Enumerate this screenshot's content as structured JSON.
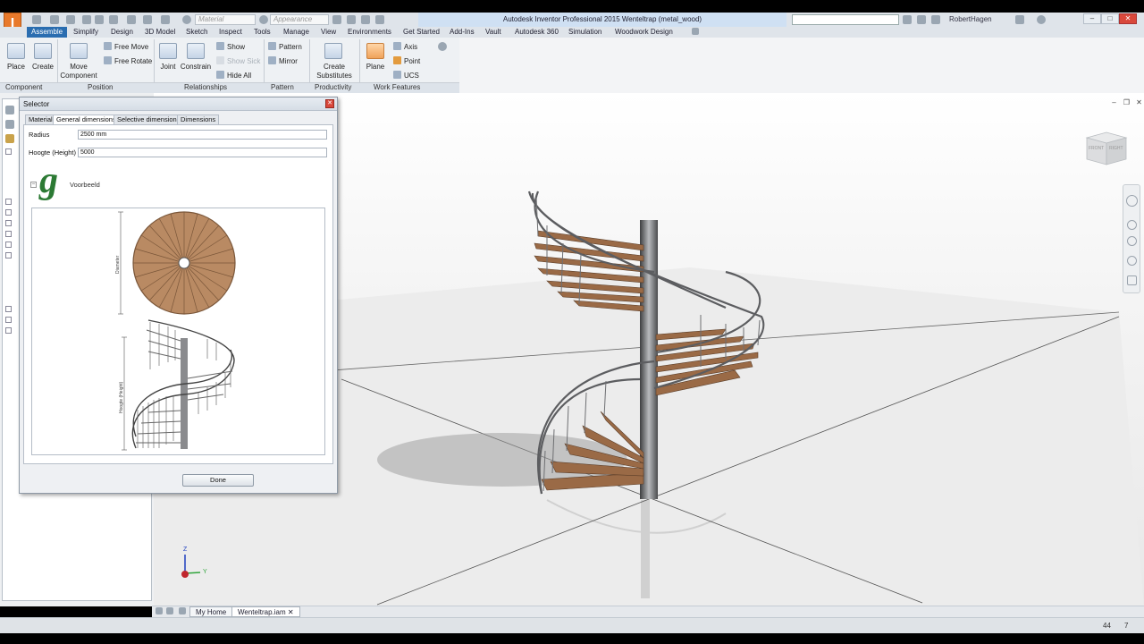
{
  "app": {
    "logo": "I",
    "title": "Autodesk Inventor Professional 2015   Wenteltrap (metal_wood)",
    "user": "RobertHagen",
    "material_placeholder": "Material",
    "appearance_placeholder": "Appearance"
  },
  "menu_tabs": [
    "Assemble",
    "Simplify",
    "Design",
    "3D Model",
    "Sketch",
    "Inspect",
    "Tools",
    "Manage",
    "View",
    "Environments",
    "Get Started",
    "Add-Ins",
    "Vault",
    "Autodesk 360",
    "Simulation",
    "Woodwork Design"
  ],
  "ribbon": {
    "place": "Place",
    "create": "Create",
    "move_component": "Move Component",
    "free_move": "Free Move",
    "free_rotate": "Free Rotate",
    "joint": "Joint",
    "constrain": "Constrain",
    "show": "Show",
    "show_sick": "Show Sick",
    "hide_all": "Hide All",
    "pattern": "Pattern",
    "mirror": "Mirror",
    "create_substitutes": "Create Substitutes",
    "plane": "Plane",
    "axis": "Axis",
    "point": "Point",
    "ucs": "UCS",
    "panels": [
      "Component",
      "Position",
      "Relationships",
      "Pattern",
      "Productivity",
      "Work Features"
    ]
  },
  "dialog": {
    "title": "Selector",
    "tabs": [
      "Material",
      "General dimensions",
      "Selective dimensions",
      "Dimensions"
    ],
    "radius_label": "Radius",
    "radius_value": "2500 mm",
    "height_label": "Hoogte (Height)",
    "height_value": "5000",
    "preview_label": "Voorbeeld",
    "diameter_label": "Diameter",
    "height_dim_label": "Hoogte (Height)",
    "done": "Done"
  },
  "viewcube": {
    "front": "FRONT",
    "right": "RIGHT"
  },
  "axes": {
    "z": "Z",
    "y": "Y"
  },
  "doc_tabs": {
    "home": "My Home",
    "file": "Wenteltrap.iam"
  },
  "status": {
    "count_a": "44",
    "count_b": "7"
  },
  "colors": {
    "accent": "#2a6db0",
    "wood": "#9a6a46",
    "metal": "#6e6f72"
  }
}
